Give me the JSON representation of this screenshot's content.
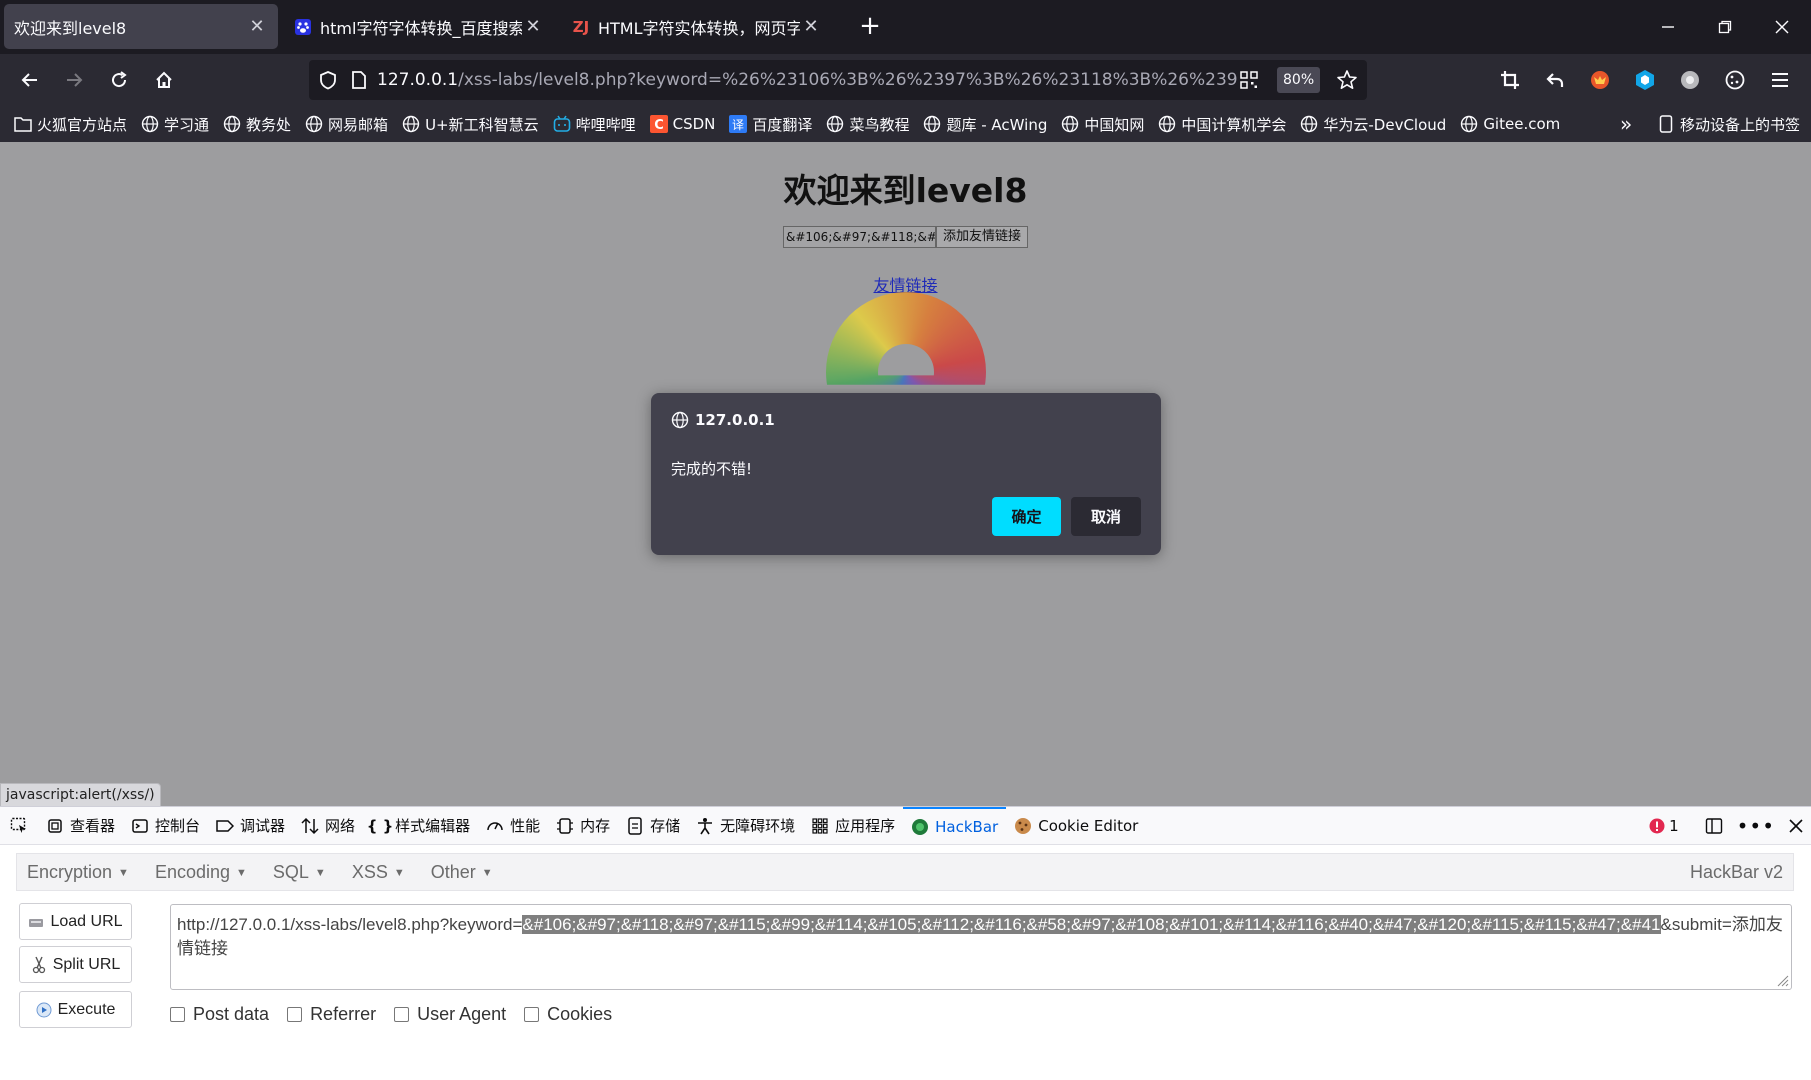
{
  "tabs": [
    {
      "title": "欢迎来到level8",
      "icon": "none",
      "active": true
    },
    {
      "title": "html字符字体转换_百度搜索",
      "icon": "baidu-paw-icon",
      "active": false
    },
    {
      "title": "HTML字符实体转换，网页字符",
      "icon": "zj-logo-icon",
      "active": false
    }
  ],
  "nav": {
    "url_host": "127.0.0.1",
    "url_rest": "/xss-labs/level8.php?keyword=%26%23106%3B%26%2397%3B%26%23118%3B%26%2397%3",
    "zoom": "80%"
  },
  "bookmarks": [
    {
      "label": "火狐官方站点",
      "icon": "folder-icon"
    },
    {
      "label": "学习通",
      "icon": "globe-icon"
    },
    {
      "label": "教务处",
      "icon": "globe-icon"
    },
    {
      "label": "网易邮箱",
      "icon": "globe-icon"
    },
    {
      "label": "U+新工科智慧云",
      "icon": "globe-icon"
    },
    {
      "label": "哔哩哔哩",
      "icon": "bilibili-icon"
    },
    {
      "label": "CSDN",
      "icon": "csdn-icon"
    },
    {
      "label": "百度翻译",
      "icon": "translate-icon"
    },
    {
      "label": "菜鸟教程",
      "icon": "globe-icon"
    },
    {
      "label": "题库 - AcWing",
      "icon": "globe-icon"
    },
    {
      "label": "中国知网",
      "icon": "globe-icon"
    },
    {
      "label": "中国计算机学会",
      "icon": "globe-icon"
    },
    {
      "label": "华为云-DevCloud",
      "icon": "globe-icon"
    },
    {
      "label": "Gitee.com",
      "icon": "globe-icon"
    }
  ],
  "bookmarks_more": "移动设备上的书签",
  "page": {
    "title": "欢迎来到level8",
    "keyword_value": "&#106;&#97;&#118;&#",
    "add_button": "添加友情链接",
    "friend_link": "友情链接"
  },
  "dialog": {
    "origin": "127.0.0.1",
    "message": "完成的不错!",
    "ok": "确定",
    "cancel": "取消"
  },
  "status_tooltip": "javascript:alert(/xss/)",
  "devtools": {
    "tabs": [
      {
        "label": "查看器",
        "icon": "inspector-icon"
      },
      {
        "label": "控制台",
        "icon": "console-icon"
      },
      {
        "label": "调试器",
        "icon": "debugger-icon"
      },
      {
        "label": "网络",
        "icon": "network-icon"
      },
      {
        "label": "样式编辑器",
        "icon": "style-editor-icon"
      },
      {
        "label": "性能",
        "icon": "performance-icon"
      },
      {
        "label": "内存",
        "icon": "memory-icon"
      },
      {
        "label": "存储",
        "icon": "storage-icon"
      },
      {
        "label": "无障碍环境",
        "icon": "accessibility-icon"
      },
      {
        "label": "应用程序",
        "icon": "application-icon"
      },
      {
        "label": "HackBar",
        "icon": "hackbar-icon",
        "selected": true
      },
      {
        "label": "Cookie Editor",
        "icon": "cookie-icon"
      }
    ],
    "error_count": "1"
  },
  "hackbar": {
    "menu": [
      "Encryption",
      "Encoding",
      "SQL",
      "XSS",
      "Other"
    ],
    "version": "HackBar v2",
    "buttons": {
      "load": "Load URL",
      "split": "Split URL",
      "execute": "Execute"
    },
    "url_prefix": "http://127.0.0.1/xss-labs/level8.php?keyword=",
    "url_selected": "&#106;&#97;&#118;&#97;&#115;&#99;&#114;&#105;&#112;&#116;&#58;&#97;&#108;&#101;&#114;&#116;&#40;&#47;&#120;&#115;&#115;&#47;&#41",
    "url_suffix": "&submit=添加友情链接",
    "options": [
      "Post data",
      "Referrer",
      "User Agent",
      "Cookies"
    ]
  },
  "colors": {
    "accent": "#00ddff",
    "tabstrip_bg": "#1c1b22",
    "toolbar_bg": "#2b2a33",
    "page_dim": "#9d9d9f",
    "devtools_selected": "#0060df"
  }
}
